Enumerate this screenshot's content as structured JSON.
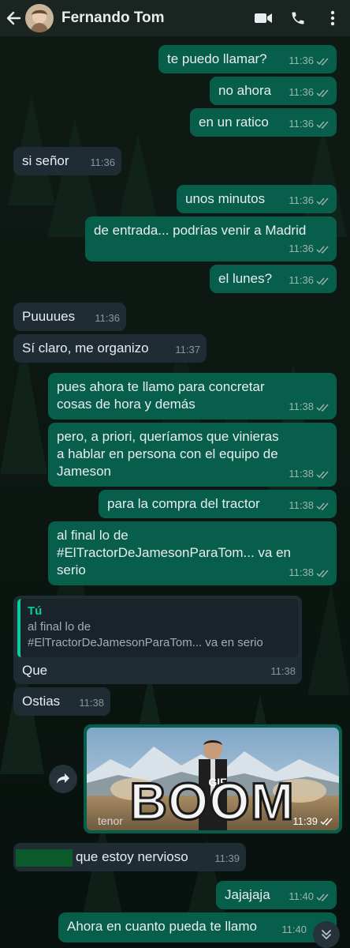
{
  "header": {
    "contact_name": "Fernando Tom",
    "icons": [
      "back-arrow-icon",
      "video-call-icon",
      "phone-icon",
      "more-vert-icon"
    ]
  },
  "colors": {
    "header_bg": "#1a2420",
    "outgoing_bubble": "#075e4b",
    "incoming_bubble": "#1f2c34",
    "read_ticks": "#9fb4ad",
    "quote_accent": "#06cf9c"
  },
  "messages": [
    {
      "dir": "out",
      "text": "te puedo llamar?",
      "time": "11:36"
    },
    {
      "dir": "out",
      "text": "no ahora",
      "time": "11:36"
    },
    {
      "dir": "out",
      "text": "en un ratico",
      "time": "11:36"
    },
    {
      "dir": "in",
      "text": "si señor",
      "time": "11:36"
    },
    {
      "dir": "out",
      "text": "unos minutos",
      "time": "11:36"
    },
    {
      "dir": "out",
      "text": "de entrada... podrías venir a Madrid",
      "time": "11:36"
    },
    {
      "dir": "out",
      "text": "el lunes?",
      "time": "11:36"
    },
    {
      "dir": "in",
      "text": "Puuuues",
      "time": "11:36"
    },
    {
      "dir": "in",
      "text": "Sí claro, me organizo",
      "time": "11:37"
    },
    {
      "dir": "out",
      "text": "pues ahora te llamo para concretar\ncosas de hora y demás",
      "time": "11:38"
    },
    {
      "dir": "out",
      "text": "pero, a priori, queríamos que vinieras\na hablar en persona con el equipo de\nJameson",
      "time": "11:38"
    },
    {
      "dir": "out",
      "text": "para la compra del tractor",
      "time": "11:38"
    },
    {
      "dir": "out",
      "text": "al final lo de\n#ElTractorDeJamesonParaTom... va en\nserio",
      "time": "11:38"
    },
    {
      "dir": "in",
      "text": "Que",
      "time": "11:38",
      "quote_author": "Tú",
      "quote_text": "al final lo de\n#ElTractorDeJamesonParaTom... va en serio"
    },
    {
      "dir": "in",
      "text": "Ostias",
      "time": "11:38"
    },
    {
      "dir": "out",
      "type": "gif",
      "overlay_text": "BOOM",
      "badge": "GIF",
      "watermark": "tenor",
      "time": "11:39"
    },
    {
      "dir": "in",
      "text": "que estoy nervioso",
      "time": "11:39"
    },
    {
      "dir": "out",
      "text": "Jajajaja",
      "time": "11:40"
    },
    {
      "dir": "out",
      "text": "Ahora en cuanto pueda te llamo",
      "time": "11:40"
    }
  ]
}
